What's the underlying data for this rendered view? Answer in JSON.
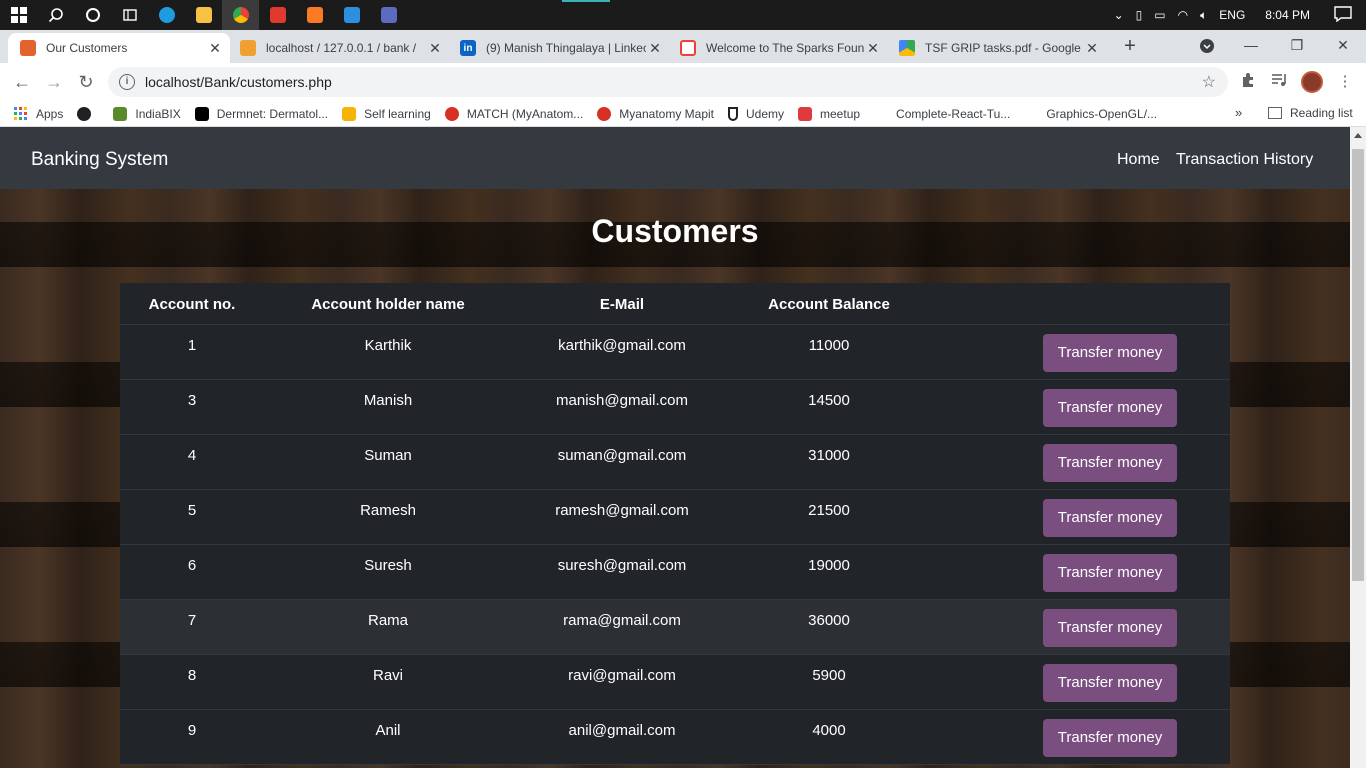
{
  "taskbar": {
    "language": "ENG",
    "time": "8:04 PM"
  },
  "browser": {
    "tabs": [
      {
        "title": "Our Customers",
        "active": true,
        "color": "#e2632b"
      },
      {
        "title": "localhost / 127.0.0.1 / bank / ",
        "active": false,
        "color": "#f0a030"
      },
      {
        "title": "(9) Manish Thingalaya | Linkec",
        "active": false,
        "color": "#0a66c2"
      },
      {
        "title": "Welcome to The Sparks Foun",
        "active": false,
        "color": "#ea4335"
      },
      {
        "title": "TSF GRIP tasks.pdf - Google D",
        "active": false,
        "color": "#34a853"
      }
    ],
    "url": "localhost/Bank/customers.php",
    "bookmarks": [
      {
        "label": "Apps",
        "color": "#4285f4"
      },
      {
        "label": "",
        "color": "#202124"
      },
      {
        "label": "IndiaBIX",
        "color": "#5a8a2a"
      },
      {
        "label": "Dermnet: Dermatol...",
        "color": "#000000"
      },
      {
        "label": "Self learning",
        "color": "#f4b400"
      },
      {
        "label": "MATCH (MyAnatom...",
        "color": "#d93025"
      },
      {
        "label": "Myanatomy Mapit",
        "color": "#d93025"
      },
      {
        "label": "Udemy",
        "color": "#202124"
      },
      {
        "label": "meetup",
        "color": "#e0393e"
      },
      {
        "label": "Complete-React-Tu...",
        "color": "#ffffff"
      },
      {
        "label": "Graphics-OpenGL/...",
        "color": "#ffffff"
      }
    ],
    "more": "»",
    "reading_list": "Reading list"
  },
  "site": {
    "brand": "Banking System",
    "nav": [
      "Home",
      "Transaction History"
    ],
    "heading": "Customers",
    "columns": [
      "Account no.",
      "Account holder name",
      "E-Mail",
      "Account Balance"
    ],
    "button_label": "Transfer money",
    "button_color": "#7a4f80",
    "customers": [
      {
        "id": "1",
        "name": "Karthik",
        "email": "karthik@gmail.com",
        "balance": "11000"
      },
      {
        "id": "3",
        "name": "Manish",
        "email": "manish@gmail.com",
        "balance": "14500"
      },
      {
        "id": "4",
        "name": "Suman",
        "email": "suman@gmail.com",
        "balance": "31000"
      },
      {
        "id": "5",
        "name": "Ramesh",
        "email": "ramesh@gmail.com",
        "balance": "21500"
      },
      {
        "id": "6",
        "name": "Suresh",
        "email": "suresh@gmail.com",
        "balance": "19000"
      },
      {
        "id": "7",
        "name": "Rama",
        "email": "rama@gmail.com",
        "balance": "36000"
      },
      {
        "id": "8",
        "name": "Ravi",
        "email": "ravi@gmail.com",
        "balance": "5900"
      },
      {
        "id": "9",
        "name": "Anil",
        "email": "anil@gmail.com",
        "balance": "4000"
      }
    ]
  }
}
